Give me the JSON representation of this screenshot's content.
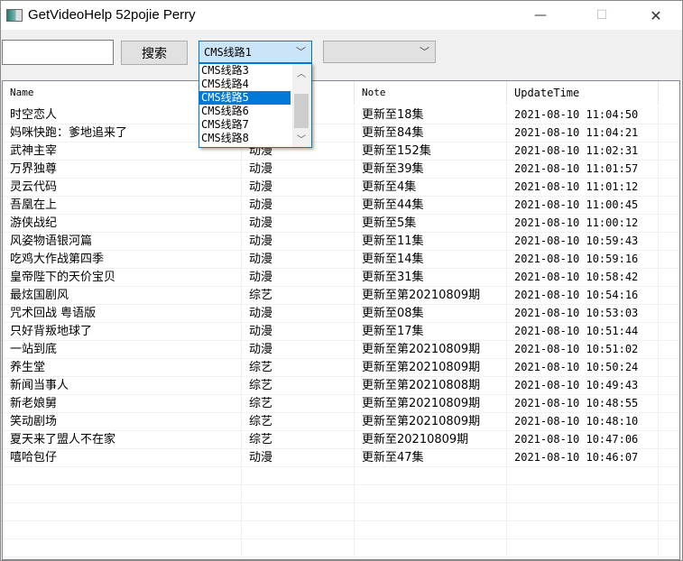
{
  "window": {
    "title": "GetVideoHelp    52pojie Perry",
    "minimize": "—",
    "maximize": "☐",
    "close": "✕"
  },
  "toolbar": {
    "search_value": "",
    "search_label": "搜索",
    "source_selected": "CMS线路1",
    "second_selected": ""
  },
  "dropdown": {
    "items": [
      "CMS线路3",
      "CMS线路4",
      "CMS线路5",
      "CMS线路6",
      "CMS线路7",
      "CMS线路8"
    ],
    "selected_index": 2
  },
  "table": {
    "headers": [
      "Name",
      "",
      "Note",
      "UpdateTime"
    ],
    "rows": [
      [
        "时空恋人",
        "",
        "更新至18集",
        "2021-08-10 11:04:50"
      ],
      [
        "妈咪快跑：爹地追来了",
        "",
        "更新至84集",
        "2021-08-10 11:04:21"
      ],
      [
        "武神主宰",
        "动漫",
        "更新至152集",
        "2021-08-10 11:02:31"
      ],
      [
        "万界独尊",
        "动漫",
        "更新至39集",
        "2021-08-10 11:01:57"
      ],
      [
        "灵云代码",
        "动漫",
        "更新至4集",
        "2021-08-10 11:01:12"
      ],
      [
        "吾凰在上",
        "动漫",
        "更新至44集",
        "2021-08-10 11:00:45"
      ],
      [
        "游侠战纪",
        "动漫",
        "更新至5集",
        "2021-08-10 11:00:12"
      ],
      [
        "风姿物语银河篇",
        "动漫",
        "更新至11集",
        "2021-08-10 10:59:43"
      ],
      [
        "吃鸡大作战第四季",
        "动漫",
        "更新至14集",
        "2021-08-10 10:59:16"
      ],
      [
        "皇帝陛下的天价宝贝",
        "动漫",
        "更新至31集",
        "2021-08-10 10:58:42"
      ],
      [
        "最炫国剧风",
        "综艺",
        "更新至第20210809期",
        "2021-08-10 10:54:16"
      ],
      [
        "咒术回战 粤语版",
        "动漫",
        "更新至08集",
        "2021-08-10 10:53:03"
      ],
      [
        "只好背叛地球了",
        "动漫",
        "更新至17集",
        "2021-08-10 10:51:44"
      ],
      [
        "一站到底",
        "动漫",
        "更新至第20210809期",
        "2021-08-10 10:51:02"
      ],
      [
        "养生堂",
        "综艺",
        "更新至第20210809期",
        "2021-08-10 10:50:24"
      ],
      [
        "新闻当事人",
        "综艺",
        "更新至第20210808期",
        "2021-08-10 10:49:43"
      ],
      [
        "新老娘舅",
        "综艺",
        "更新至第20210809期",
        "2021-08-10 10:48:55"
      ],
      [
        "笑动剧场",
        "综艺",
        "更新至第20210809期",
        "2021-08-10 10:48:10"
      ],
      [
        "夏天来了盟人不在家",
        "综艺",
        "更新至20210809期",
        "2021-08-10 10:47:06"
      ],
      [
        "嘻哈包仔",
        "动漫",
        "更新至47集",
        "2021-08-10 10:46:07"
      ]
    ],
    "empty_rows": 5
  }
}
